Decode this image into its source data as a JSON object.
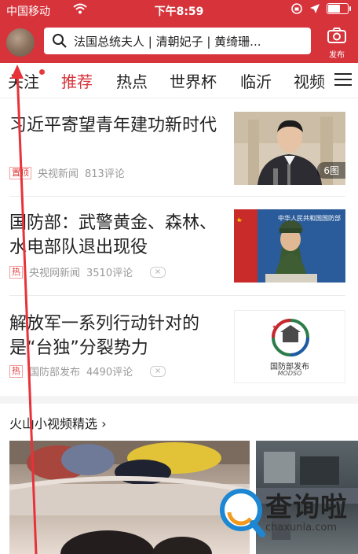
{
  "status_bar": {
    "carrier": "中国移动",
    "time": "下午8:59"
  },
  "header": {
    "search_text": "法国总统夫人 | 清朝妃子 | 黄绮珊...",
    "publish_label": "发布",
    "accent_color": "#d6333b"
  },
  "tabs": [
    {
      "label": "关注"
    },
    {
      "label": "推荐"
    },
    {
      "label": "热点"
    },
    {
      "label": "世界杯"
    },
    {
      "label": "临沂"
    },
    {
      "label": "视频"
    }
  ],
  "news": [
    {
      "title": "习近平寄望青年建功新时代",
      "tag": "置顶",
      "source": "央视新闻",
      "comments": "813评论",
      "image_badge": "6图"
    },
    {
      "title": "国防部：武警黄金、森林、水电部队退出现役",
      "tag": "热",
      "source": "央视网新闻",
      "comments": "3510评论",
      "dismiss": "×",
      "image_banner": "中华人民共和国国防部"
    },
    {
      "title": "解放军一系列行动针对的是“台独”分裂势力",
      "tag": "热",
      "source": "国防部发布",
      "comments": "4490评论",
      "dismiss": "×",
      "image_caption": "国防部发布",
      "image_caption_en": "MODSO"
    }
  ],
  "video_section": {
    "title": "火山小视频精选 ›"
  },
  "watermark": {
    "text": "查询啦",
    "sub": "chaxunla.com"
  }
}
